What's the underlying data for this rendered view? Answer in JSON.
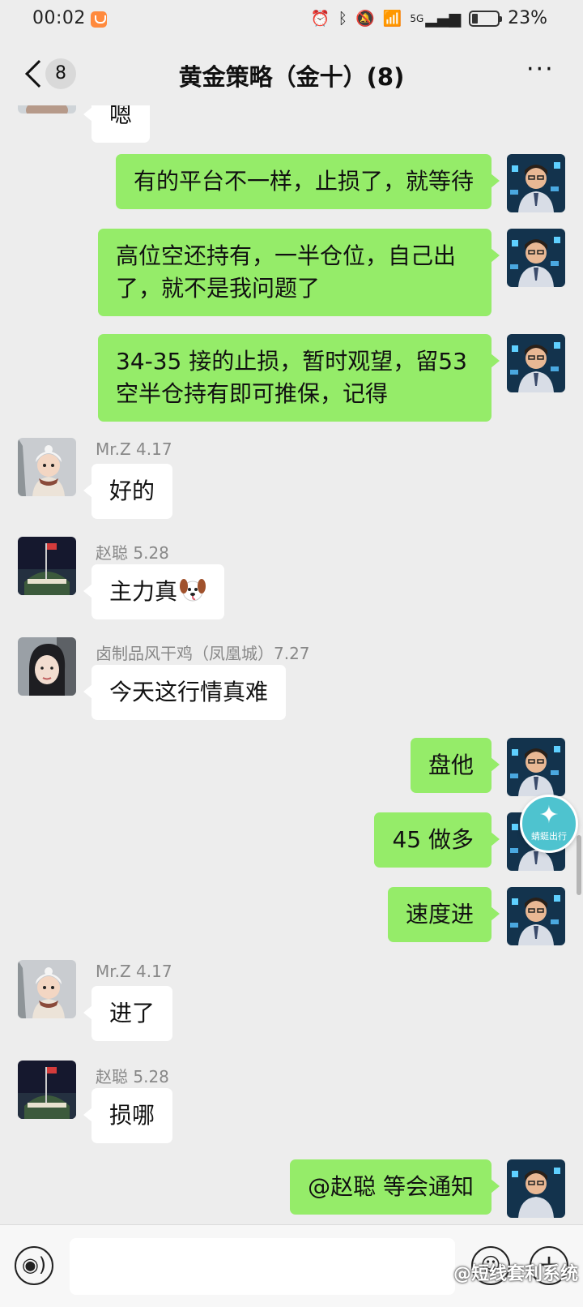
{
  "status_bar": {
    "time": "00:02",
    "battery": "23%",
    "network": "5G"
  },
  "header": {
    "back_count": "8",
    "title": "黄金策略（金十）(8)",
    "more": "···"
  },
  "messages": [
    {
      "direction": "in",
      "sender": "",
      "text": "嗯"
    },
    {
      "direction": "out",
      "text": "有的平台不一样，止损了，就等待"
    },
    {
      "direction": "out",
      "text": "高位空还持有，一半仓位，自己出了，就不是我问题了"
    },
    {
      "direction": "out",
      "text": "34-35 接的止损，暂时观望，留53 空半仓持有即可推保，记得"
    },
    {
      "direction": "in",
      "sender": "Mr.Z 4.17",
      "text": "好的"
    },
    {
      "direction": "in",
      "sender": "赵聪  5.28",
      "text": "主力真"
    },
    {
      "direction": "in",
      "sender": "卤制品风干鸡（凤凰城）7.27",
      "text": "今天这行情真难"
    },
    {
      "direction": "out",
      "text": "盘他"
    },
    {
      "direction": "out",
      "text": "45 做多"
    },
    {
      "direction": "out",
      "text": "速度进"
    },
    {
      "direction": "in",
      "sender": "Mr.Z 4.17",
      "text": "进了"
    },
    {
      "direction": "in",
      "sender": "赵聪  5.28",
      "text": "损哪"
    },
    {
      "direction": "out",
      "text": "@赵聪  等会通知"
    }
  ],
  "float_badge": {
    "text": "蜻蜓出行"
  },
  "input_bar": {
    "watermark": "@短线套利系统"
  },
  "icons": {
    "voice": "voice-icon",
    "emoji": "emoji-icon",
    "plus": "plus-icon",
    "dog": "dog-face-emoji"
  },
  "colors": {
    "outgoing_bubble": "#95ec69",
    "incoming_bubble": "#ffffff",
    "background": "#ededed"
  }
}
